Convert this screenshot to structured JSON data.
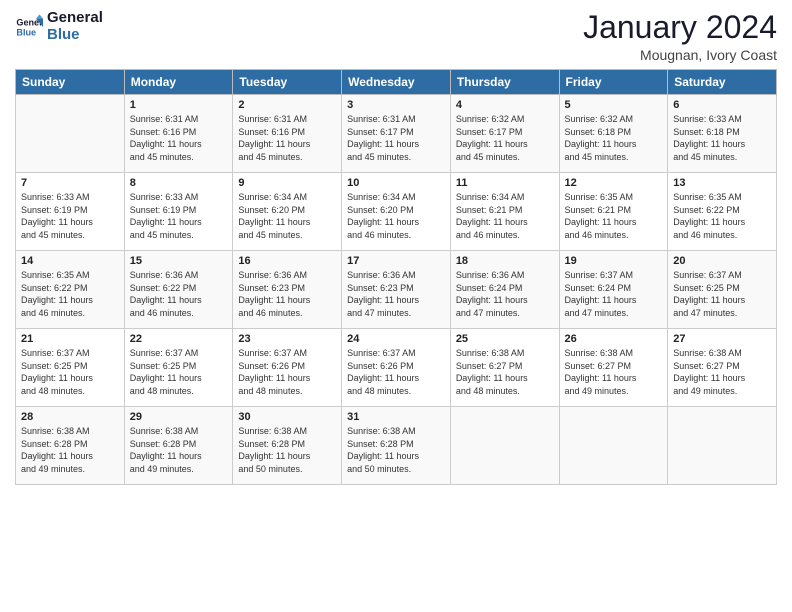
{
  "header": {
    "logo_line1": "General",
    "logo_line2": "Blue",
    "month": "January 2024",
    "location": "Mougnan, Ivory Coast"
  },
  "days_of_week": [
    "Sunday",
    "Monday",
    "Tuesday",
    "Wednesday",
    "Thursday",
    "Friday",
    "Saturday"
  ],
  "weeks": [
    [
      {
        "num": "",
        "info": ""
      },
      {
        "num": "1",
        "info": "Sunrise: 6:31 AM\nSunset: 6:16 PM\nDaylight: 11 hours\nand 45 minutes."
      },
      {
        "num": "2",
        "info": "Sunrise: 6:31 AM\nSunset: 6:16 PM\nDaylight: 11 hours\nand 45 minutes."
      },
      {
        "num": "3",
        "info": "Sunrise: 6:31 AM\nSunset: 6:17 PM\nDaylight: 11 hours\nand 45 minutes."
      },
      {
        "num": "4",
        "info": "Sunrise: 6:32 AM\nSunset: 6:17 PM\nDaylight: 11 hours\nand 45 minutes."
      },
      {
        "num": "5",
        "info": "Sunrise: 6:32 AM\nSunset: 6:18 PM\nDaylight: 11 hours\nand 45 minutes."
      },
      {
        "num": "6",
        "info": "Sunrise: 6:33 AM\nSunset: 6:18 PM\nDaylight: 11 hours\nand 45 minutes."
      }
    ],
    [
      {
        "num": "7",
        "info": "Sunrise: 6:33 AM\nSunset: 6:19 PM\nDaylight: 11 hours\nand 45 minutes."
      },
      {
        "num": "8",
        "info": "Sunrise: 6:33 AM\nSunset: 6:19 PM\nDaylight: 11 hours\nand 45 minutes."
      },
      {
        "num": "9",
        "info": "Sunrise: 6:34 AM\nSunset: 6:20 PM\nDaylight: 11 hours\nand 45 minutes."
      },
      {
        "num": "10",
        "info": "Sunrise: 6:34 AM\nSunset: 6:20 PM\nDaylight: 11 hours\nand 46 minutes."
      },
      {
        "num": "11",
        "info": "Sunrise: 6:34 AM\nSunset: 6:21 PM\nDaylight: 11 hours\nand 46 minutes."
      },
      {
        "num": "12",
        "info": "Sunrise: 6:35 AM\nSunset: 6:21 PM\nDaylight: 11 hours\nand 46 minutes."
      },
      {
        "num": "13",
        "info": "Sunrise: 6:35 AM\nSunset: 6:22 PM\nDaylight: 11 hours\nand 46 minutes."
      }
    ],
    [
      {
        "num": "14",
        "info": "Sunrise: 6:35 AM\nSunset: 6:22 PM\nDaylight: 11 hours\nand 46 minutes."
      },
      {
        "num": "15",
        "info": "Sunrise: 6:36 AM\nSunset: 6:22 PM\nDaylight: 11 hours\nand 46 minutes."
      },
      {
        "num": "16",
        "info": "Sunrise: 6:36 AM\nSunset: 6:23 PM\nDaylight: 11 hours\nand 46 minutes."
      },
      {
        "num": "17",
        "info": "Sunrise: 6:36 AM\nSunset: 6:23 PM\nDaylight: 11 hours\nand 47 minutes."
      },
      {
        "num": "18",
        "info": "Sunrise: 6:36 AM\nSunset: 6:24 PM\nDaylight: 11 hours\nand 47 minutes."
      },
      {
        "num": "19",
        "info": "Sunrise: 6:37 AM\nSunset: 6:24 PM\nDaylight: 11 hours\nand 47 minutes."
      },
      {
        "num": "20",
        "info": "Sunrise: 6:37 AM\nSunset: 6:25 PM\nDaylight: 11 hours\nand 47 minutes."
      }
    ],
    [
      {
        "num": "21",
        "info": "Sunrise: 6:37 AM\nSunset: 6:25 PM\nDaylight: 11 hours\nand 48 minutes."
      },
      {
        "num": "22",
        "info": "Sunrise: 6:37 AM\nSunset: 6:25 PM\nDaylight: 11 hours\nand 48 minutes."
      },
      {
        "num": "23",
        "info": "Sunrise: 6:37 AM\nSunset: 6:26 PM\nDaylight: 11 hours\nand 48 minutes."
      },
      {
        "num": "24",
        "info": "Sunrise: 6:37 AM\nSunset: 6:26 PM\nDaylight: 11 hours\nand 48 minutes."
      },
      {
        "num": "25",
        "info": "Sunrise: 6:38 AM\nSunset: 6:27 PM\nDaylight: 11 hours\nand 48 minutes."
      },
      {
        "num": "26",
        "info": "Sunrise: 6:38 AM\nSunset: 6:27 PM\nDaylight: 11 hours\nand 49 minutes."
      },
      {
        "num": "27",
        "info": "Sunrise: 6:38 AM\nSunset: 6:27 PM\nDaylight: 11 hours\nand 49 minutes."
      }
    ],
    [
      {
        "num": "28",
        "info": "Sunrise: 6:38 AM\nSunset: 6:28 PM\nDaylight: 11 hours\nand 49 minutes."
      },
      {
        "num": "29",
        "info": "Sunrise: 6:38 AM\nSunset: 6:28 PM\nDaylight: 11 hours\nand 49 minutes."
      },
      {
        "num": "30",
        "info": "Sunrise: 6:38 AM\nSunset: 6:28 PM\nDaylight: 11 hours\nand 50 minutes."
      },
      {
        "num": "31",
        "info": "Sunrise: 6:38 AM\nSunset: 6:28 PM\nDaylight: 11 hours\nand 50 minutes."
      },
      {
        "num": "",
        "info": ""
      },
      {
        "num": "",
        "info": ""
      },
      {
        "num": "",
        "info": ""
      }
    ]
  ]
}
